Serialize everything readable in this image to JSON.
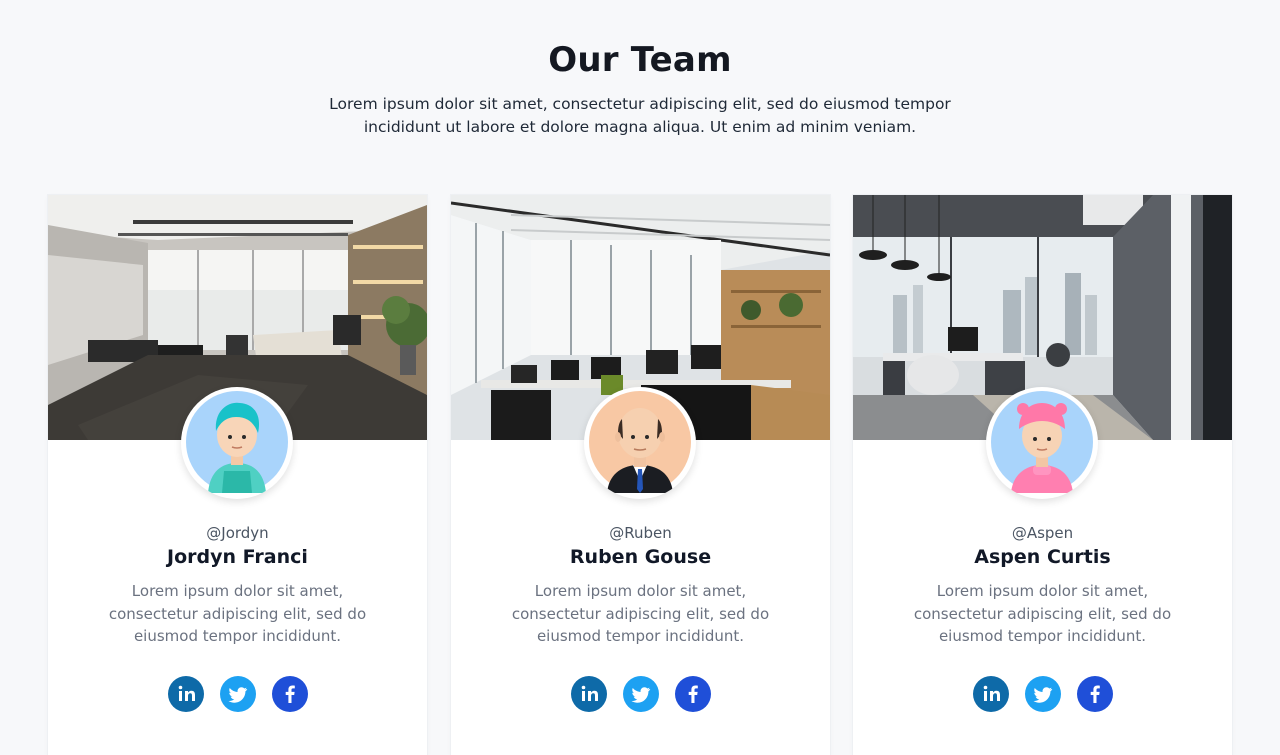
{
  "header": {
    "title": "Our Team",
    "subtitle": "Lorem ipsum dolor sit amet, consectetur adipiscing elit, sed do eiusmod tempor incididunt ut labore et dolore magna aliqua. Ut enim ad minim veniam."
  },
  "team": [
    {
      "handle": "@Jordyn",
      "name": "Jordyn Franci",
      "description": "Lorem ipsum dolor sit amet, consectetur adipiscing elit, sed do eiusmod tempor incididunt.",
      "image": "office-interior-image",
      "avatar": "teal-hair-avatar"
    },
    {
      "handle": "@Ruben",
      "name": "Ruben Gouse",
      "description": "Lorem ipsum dolor sit amet, consectetur adipiscing elit, sed do eiusmod tempor incididunt.",
      "image": "open-office-image",
      "avatar": "business-man-avatar"
    },
    {
      "handle": "@Aspen",
      "name": "Aspen Curtis",
      "description": "Lorem ipsum dolor sit amet, consectetur adipiscing elit, sed do eiusmod tempor incididunt.",
      "image": "city-view-office-image",
      "avatar": "pink-cap-avatar"
    }
  ],
  "social_icons": [
    "linkedin-icon",
    "twitter-icon",
    "facebook-icon"
  ],
  "colors": {
    "linkedin": "#0e6aa8",
    "twitter": "#1da1f2",
    "facebook": "#1f4fd8",
    "background": "#f7f8fa"
  }
}
